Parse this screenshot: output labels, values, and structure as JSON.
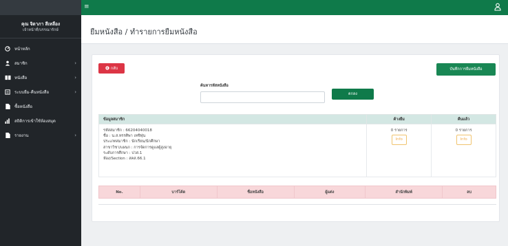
{
  "sidebar": {
    "user_name": "คุณ จิดาภา สีเหลือง",
    "user_role": "เจ้าหน้าที่/บรรณารักษ์",
    "items": [
      {
        "label": "หน้าหลัก",
        "icon": "dashboard-icon",
        "has_arrow": false
      },
      {
        "label": "สมาชิก",
        "icon": "user-icon",
        "has_arrow": true
      },
      {
        "label": "หนังสือ",
        "icon": "book-icon",
        "has_arrow": true
      },
      {
        "label": "ระบบยืม-คืนหนังสือ",
        "icon": "exchange-icon",
        "has_arrow": true
      },
      {
        "label": "ซื้อหนังสือ",
        "icon": "file-icon",
        "has_arrow": false
      },
      {
        "label": "สถิติการเข้าใช้ห้องสมุด",
        "icon": "bar-chart-icon",
        "has_arrow": false
      },
      {
        "label": "รายงาน",
        "icon": "file-icon",
        "has_arrow": true
      }
    ]
  },
  "topbar": {
    "menu_icon": "hamburger-icon",
    "user_icon": "user-icon",
    "accent": "#0f7a4a"
  },
  "page": {
    "title": "ยืมหนังสือ / ทำรายการยืมหนังสือ"
  },
  "actions": {
    "back_label": "กลับ",
    "save_label": "บันทึกการยืมหนังสือ",
    "search_label": "ค้นหารหัสหนังสือ",
    "search_placeholder": "",
    "search_button": "ตกลง"
  },
  "member_table": {
    "headers": [
      "ข้อมูลสมาชิก",
      "ค้างยืม",
      "คืนแล้ว"
    ],
    "info": [
      "รหัสสมาชิก : 66204040018",
      "ชื่อ : น.ส.ทรรศิพา เทชิฬุน",
      "ประเภทสมาชิก : นักเรียน/นักศึกษา",
      "สาขาวิชา/แผนก : การจัดการดูแลผู้สูงอายุ",
      "ระดับการศึกษา : ปวส.1",
      "ห้อง/Section : สคส.66.1"
    ],
    "borrowed_count": "0 รายการ",
    "returned_count": "0 รายการ",
    "info_button": "Info"
  },
  "book_table": {
    "headers": [
      "No.",
      "บาร์โค้ด",
      "ชื่อหนังสือ",
      "ผู้แต่ง",
      "สำนักพิมพ์",
      "ลบ"
    ]
  },
  "colors": {
    "danger": "#dc3545",
    "success": "#198754",
    "warning": "#f0ad4e"
  }
}
